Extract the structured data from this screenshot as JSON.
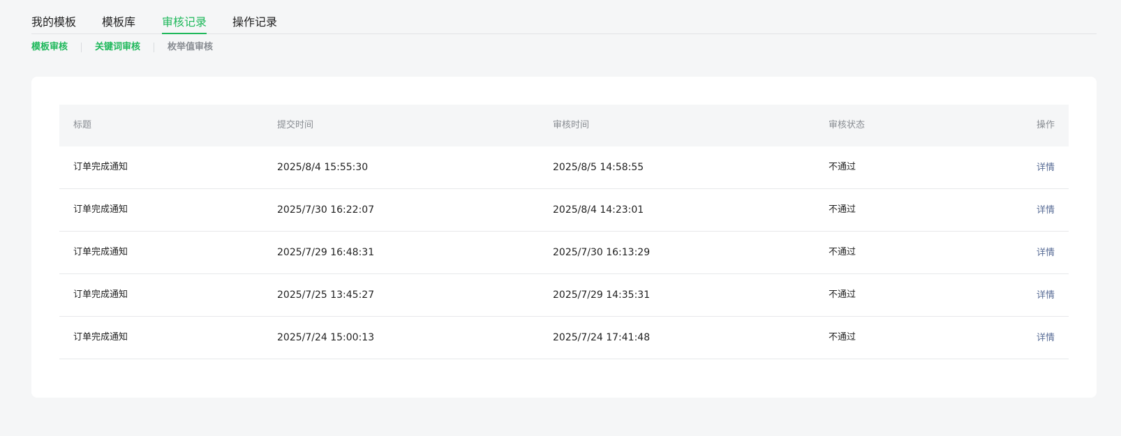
{
  "top_tabs": {
    "my_templates": "我的模板",
    "template_library": "模板库",
    "review_records": "审核记录",
    "operation_records": "操作记录"
  },
  "sub_tabs": {
    "template_review": "模板审核",
    "keyword_review": "关键词审核",
    "enum_review": "枚举值审核"
  },
  "table": {
    "headers": {
      "title": "标题",
      "submit_time": "提交时间",
      "review_time": "审核时间",
      "review_status": "审核状态",
      "action": "操作"
    },
    "rows": [
      {
        "title": "订单完成通知",
        "submit_time": "2025/8/4 15:55:30",
        "review_time": "2025/8/5 14:58:55",
        "status": "不通过",
        "action": "详情"
      },
      {
        "title": "订单完成通知",
        "submit_time": "2025/7/30 16:22:07",
        "review_time": "2025/8/4 14:23:01",
        "status": "不通过",
        "action": "详情"
      },
      {
        "title": "订单完成通知",
        "submit_time": "2025/7/29 16:48:31",
        "review_time": "2025/7/30 16:13:29",
        "status": "不通过",
        "action": "详情"
      },
      {
        "title": "订单完成通知",
        "submit_time": "2025/7/25 13:45:27",
        "review_time": "2025/7/29 14:35:31",
        "status": "不通过",
        "action": "详情"
      },
      {
        "title": "订单完成通知",
        "submit_time": "2025/7/24 15:00:13",
        "review_time": "2025/7/24 17:41:48",
        "status": "不通过",
        "action": "详情"
      }
    ]
  },
  "colors": {
    "accent": "#1fb85b",
    "link": "#576b95",
    "background": "#f5f6f7"
  }
}
